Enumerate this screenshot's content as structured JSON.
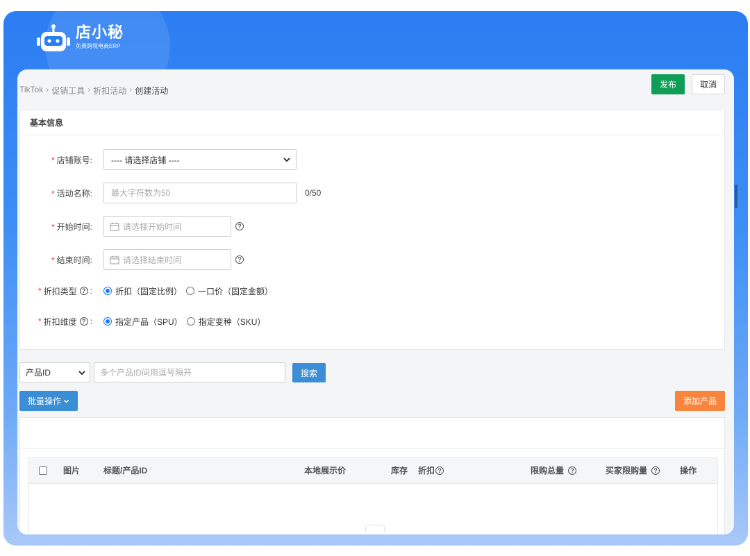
{
  "brand": {
    "name": "店小秘",
    "tagline": "免费跨境电商ERP"
  },
  "breadcrumb": [
    "TikTok",
    "促销工具",
    "折扣活动",
    "创建活动"
  ],
  "actions": {
    "publish": "发布",
    "cancel": "取消"
  },
  "section": {
    "title": "基本信息",
    "store": {
      "label": "店铺账号:",
      "value": "---- 请选择店铺 ----"
    },
    "name": {
      "label": "活动名称:",
      "placeholder": "最大字符数为50",
      "counter": "0/50"
    },
    "start": {
      "label": "开始时间:",
      "placeholder": "请选择开始时间"
    },
    "end": {
      "label": "结束时间:",
      "placeholder": "请选择结束时间"
    },
    "discount_type": {
      "label": "折扣类型",
      "options": [
        "折扣（固定比例）",
        "一口价（固定金额）"
      ],
      "selected": 0
    },
    "discount_dim": {
      "label": "折扣维度",
      "options": [
        "指定产品（SPU）",
        "指定变种（SKU）"
      ],
      "selected": 0
    }
  },
  "filter": {
    "field": "产品ID",
    "placeholder": "多个产品ID间用逗号隔开",
    "search": "搜索"
  },
  "toolbar": {
    "batch": "批量操作",
    "add": "添加产品"
  },
  "table": {
    "columns": [
      "图片",
      "标题/产品ID",
      "本地展示价",
      "库存",
      "折扣",
      "限购总量",
      "买家限购量",
      "操作"
    ]
  },
  "colors": {
    "primary": "#3b8ed5",
    "success": "#0f9d58",
    "warning": "#f8853c",
    "frame": "#2b7df2"
  }
}
